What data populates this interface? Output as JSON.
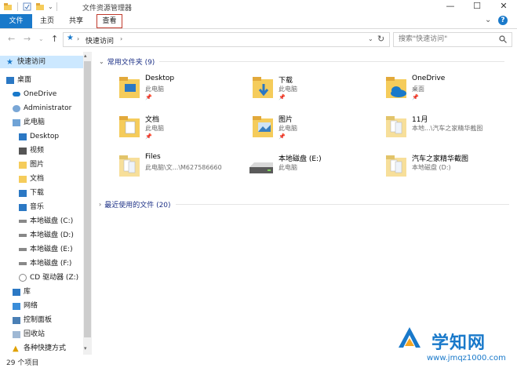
{
  "window": {
    "title": "文件资源管理器",
    "controls": [
      "—",
      "☐",
      "✕"
    ]
  },
  "ribbon": {
    "tabs": [
      {
        "label": "文件",
        "active": true
      },
      {
        "label": "主页"
      },
      {
        "label": "共享"
      },
      {
        "label": "查看",
        "highlighted": true
      }
    ],
    "expand_icon": "chevron-down-icon",
    "help_label": "?"
  },
  "address": {
    "path_root_icon": "star-icon",
    "path": "快速访问",
    "search_placeholder": "搜索\"快速访问\""
  },
  "nav": {
    "items": [
      {
        "label": "快速访问",
        "icon": "star-icon",
        "level": 0,
        "selected": true
      },
      {
        "label": "桌面",
        "icon": "desktop-icon",
        "level": 0
      },
      {
        "label": "OneDrive",
        "icon": "cloud-icon",
        "level": 1
      },
      {
        "label": "Administrator",
        "icon": "user-icon",
        "level": 1
      },
      {
        "label": "此电脑",
        "icon": "computer-icon",
        "level": 1
      },
      {
        "label": "Desktop",
        "icon": "desktop-folder-icon",
        "level": 2
      },
      {
        "label": "视频",
        "icon": "video-folder-icon",
        "level": 2
      },
      {
        "label": "图片",
        "icon": "pictures-folder-icon",
        "level": 2
      },
      {
        "label": "文档",
        "icon": "documents-folder-icon",
        "level": 2
      },
      {
        "label": "下载",
        "icon": "downloads-folder-icon",
        "level": 2
      },
      {
        "label": "音乐",
        "icon": "music-folder-icon",
        "level": 2
      },
      {
        "label": "本地磁盘 (C:)",
        "icon": "drive-icon",
        "level": 2
      },
      {
        "label": "本地磁盘 (D:)",
        "icon": "drive-icon",
        "level": 2
      },
      {
        "label": "本地磁盘 (E:)",
        "icon": "drive-icon",
        "level": 2
      },
      {
        "label": "本地磁盘 (F:)",
        "icon": "drive-icon",
        "level": 2
      },
      {
        "label": "CD 驱动器 (Z:)",
        "icon": "cd-icon",
        "level": 2
      },
      {
        "label": "库",
        "icon": "library-icon",
        "level": 1
      },
      {
        "label": "网络",
        "icon": "network-icon",
        "level": 1
      },
      {
        "label": "控制面板",
        "icon": "control-panel-icon",
        "level": 1
      },
      {
        "label": "回收站",
        "icon": "recycle-bin-icon",
        "level": 1
      },
      {
        "label": "各种快捷方式",
        "icon": "warning-icon",
        "level": 1
      }
    ]
  },
  "content": {
    "frequent_header": "常用文件夹 (9)",
    "recent_header": "最近使用的文件 (20)",
    "folders": [
      {
        "name": "Desktop",
        "sub": "此电脑",
        "pinned": true,
        "icon": "desktop-folder-icon"
      },
      {
        "name": "下载",
        "sub": "此电脑",
        "pinned": true,
        "icon": "downloads-folder-icon"
      },
      {
        "name": "OneDrive",
        "sub": "桌面",
        "pinned": true,
        "icon": "onedrive-folder-icon"
      },
      {
        "name": "文档",
        "sub": "此电脑",
        "pinned": true,
        "icon": "documents-folder-icon"
      },
      {
        "name": "图片",
        "sub": "此电脑",
        "pinned": true,
        "icon": "pictures-folder-icon"
      },
      {
        "name": "11月",
        "sub": "本地...\\汽车之家精华截图",
        "pinned": false,
        "icon": "folder-icon"
      },
      {
        "name": "Files",
        "sub": "此电脑\\文...\\M627586660",
        "pinned": false,
        "icon": "folder-icon"
      },
      {
        "name": "本地磁盘 (E:)",
        "sub": "此电脑",
        "pinned": false,
        "icon": "drive-icon"
      },
      {
        "name": "汽车之家精华截图",
        "sub": "本地磁盘 (D:)",
        "pinned": false,
        "icon": "folder-icon"
      }
    ],
    "pin_glyph": "📌"
  },
  "status": {
    "items_count": "29 个项目"
  },
  "watermark": {
    "brand": "学知网",
    "url": "www.jmqz1000.com"
  },
  "colors": {
    "accent": "#1979ca",
    "folder": "#f5cc5b",
    "view_tab_border": "#c0392b"
  }
}
